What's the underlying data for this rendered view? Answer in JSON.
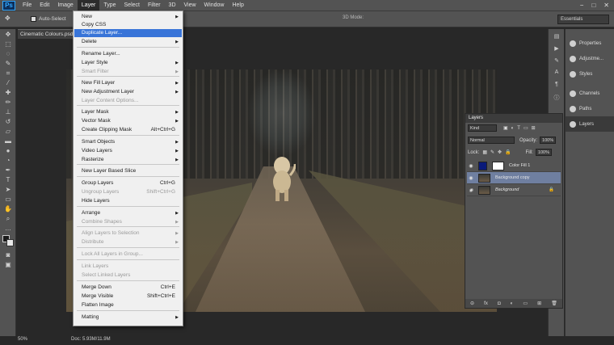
{
  "menubar": {
    "logo": "Ps",
    "items": [
      "File",
      "Edit",
      "Image",
      "Layer",
      "Type",
      "Select",
      "Filter",
      "3D",
      "View",
      "Window",
      "Help"
    ],
    "controls": [
      "−",
      "□",
      "✕"
    ]
  },
  "options": {
    "auto_select_label": "Auto-Select",
    "mode_3d_label": "3D Mode:",
    "workspace": "Essentials"
  },
  "document": {
    "tab_title": "Cinematic Colours.psd",
    "zoom": "50%",
    "info": "Doc: 5.93M/11.9M"
  },
  "layer_menu": {
    "items": [
      {
        "label": "New",
        "shortcut": "",
        "submenu": true,
        "disabled": false
      },
      {
        "label": "Copy CSS",
        "shortcut": "",
        "submenu": false,
        "disabled": false
      },
      {
        "label": "Duplicate Layer...",
        "shortcut": "",
        "submenu": false,
        "disabled": false,
        "selected": true
      },
      {
        "label": "Delete",
        "shortcut": "",
        "submenu": true,
        "disabled": false
      },
      {
        "label": "Rename Layer...",
        "shortcut": "",
        "submenu": false,
        "disabled": false
      },
      {
        "label": "Layer Style",
        "shortcut": "",
        "submenu": true,
        "disabled": false
      },
      {
        "label": "Smart Filter",
        "shortcut": "",
        "submenu": true,
        "disabled": true
      },
      {
        "label": "New Fill Layer",
        "shortcut": "",
        "submenu": true,
        "disabled": false
      },
      {
        "label": "New Adjustment Layer",
        "shortcut": "",
        "submenu": true,
        "disabled": false
      },
      {
        "label": "Layer Content Options...",
        "shortcut": "",
        "submenu": false,
        "disabled": true
      },
      {
        "label": "Layer Mask",
        "shortcut": "",
        "submenu": true,
        "disabled": false
      },
      {
        "label": "Vector Mask",
        "shortcut": "",
        "submenu": true,
        "disabled": false
      },
      {
        "label": "Create Clipping Mask",
        "shortcut": "Alt+Ctrl+G",
        "submenu": false,
        "disabled": false
      },
      {
        "label": "Smart Objects",
        "shortcut": "",
        "submenu": true,
        "disabled": false
      },
      {
        "label": "Video Layers",
        "shortcut": "",
        "submenu": true,
        "disabled": false
      },
      {
        "label": "Rasterize",
        "shortcut": "",
        "submenu": true,
        "disabled": false
      },
      {
        "label": "New Layer Based Slice",
        "shortcut": "",
        "submenu": false,
        "disabled": false
      },
      {
        "label": "Group Layers",
        "shortcut": "Ctrl+G",
        "submenu": false,
        "disabled": false
      },
      {
        "label": "Ungroup Layers",
        "shortcut": "Shift+Ctrl+G",
        "submenu": false,
        "disabled": true
      },
      {
        "label": "Hide Layers",
        "shortcut": "",
        "submenu": false,
        "disabled": false
      },
      {
        "label": "Arrange",
        "shortcut": "",
        "submenu": true,
        "disabled": false
      },
      {
        "label": "Combine Shapes",
        "shortcut": "",
        "submenu": true,
        "disabled": true
      },
      {
        "label": "Align Layers to Selection",
        "shortcut": "",
        "submenu": true,
        "disabled": true
      },
      {
        "label": "Distribute",
        "shortcut": "",
        "submenu": true,
        "disabled": true
      },
      {
        "label": "Lock All Layers in Group...",
        "shortcut": "",
        "submenu": false,
        "disabled": true
      },
      {
        "label": "Link Layers",
        "shortcut": "",
        "submenu": false,
        "disabled": true
      },
      {
        "label": "Select Linked Layers",
        "shortcut": "",
        "submenu": false,
        "disabled": true
      },
      {
        "label": "Merge Down",
        "shortcut": "Ctrl+E",
        "submenu": false,
        "disabled": false
      },
      {
        "label": "Merge Visible",
        "shortcut": "Shift+Ctrl+E",
        "submenu": false,
        "disabled": false
      },
      {
        "label": "Flatten Image",
        "shortcut": "",
        "submenu": false,
        "disabled": false
      },
      {
        "label": "Matting",
        "shortcut": "",
        "submenu": true,
        "disabled": false
      }
    ]
  },
  "panel_tabs": [
    "Properties",
    "Adjustme...",
    "Styles",
    "Channels",
    "Paths",
    "Layers"
  ],
  "layers_panel": {
    "title": "Layers",
    "kind_label": "Kind",
    "blend_mode": "Normal",
    "opacity_label": "Opacity:",
    "opacity_value": "100%",
    "lock_label": "Lock:",
    "fill_label": "Fill:",
    "fill_value": "100%",
    "layers": [
      {
        "name": "Color Fill 1",
        "selected": false,
        "locked": false
      },
      {
        "name": "Background copy",
        "selected": true,
        "locked": false
      },
      {
        "name": "Background",
        "selected": false,
        "locked": true
      }
    ],
    "colors": {
      "fill_swatch": "#0a1a7a",
      "selected_row": "#6f7fa0"
    }
  }
}
